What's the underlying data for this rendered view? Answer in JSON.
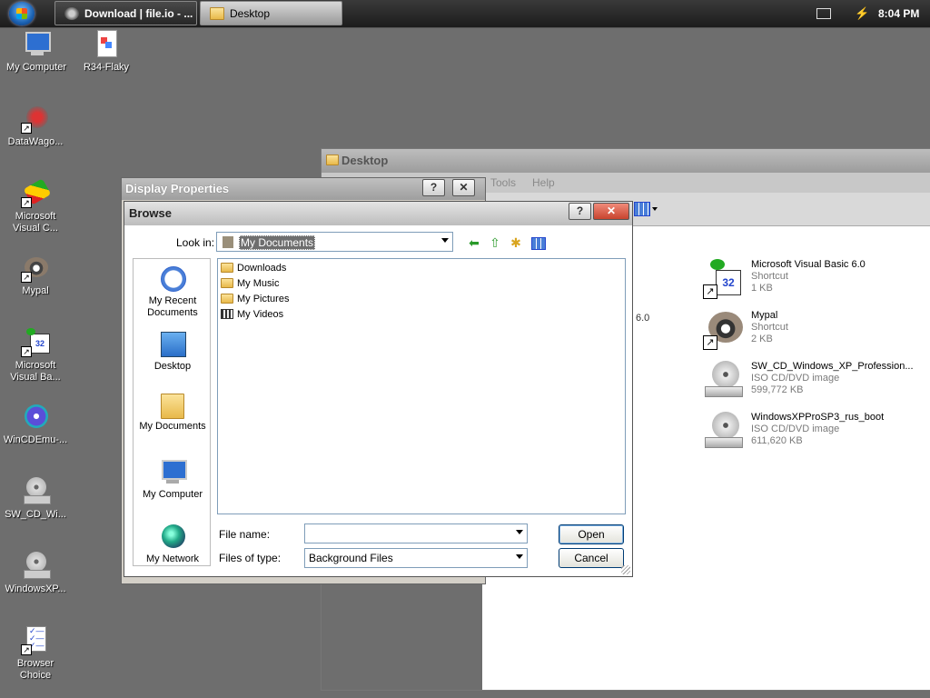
{
  "taskbar": {
    "tasks": [
      {
        "label": "Download | file.io - ..."
      },
      {
        "label": "Desktop"
      }
    ],
    "clock": "8:04 PM"
  },
  "desktop": {
    "icons": [
      {
        "label": "My Computer"
      },
      {
        "label": "R34-Flaky"
      },
      {
        "label": "DataWago..."
      },
      {
        "label": "Microsoft Visual C..."
      },
      {
        "label": "Mypal"
      },
      {
        "label": "Microsoft Visual Ba..."
      },
      {
        "label": "WinCDEmu-..."
      },
      {
        "label": "SW_CD_Wi..."
      },
      {
        "label": "WindowsXP..."
      },
      {
        "label": "Browser Choice"
      }
    ]
  },
  "explorer": {
    "title": "Desktop",
    "menu": [
      "Tools",
      "Help"
    ],
    "stray_text": "6.0",
    "files": [
      {
        "name": "Microsoft Visual Basic 6.0",
        "type": "Shortcut",
        "size": "1 KB"
      },
      {
        "name": "Mypal",
        "type": "Shortcut",
        "size": "2 KB"
      },
      {
        "name": "SW_CD_Windows_XP_Profession...",
        "type": "ISO CD/DVD image",
        "size": "599,772 KB"
      },
      {
        "name": "WindowsXPProSP3_rus_boot",
        "type": "ISO CD/DVD image",
        "size": "611,620 KB"
      }
    ]
  },
  "display_properties": {
    "title": "Display Properties",
    "help": "?",
    "close": "✕"
  },
  "browse": {
    "title": "Browse",
    "help": "?",
    "close": "✕",
    "look_in_label": "Look in:",
    "look_in_value": "My Documents",
    "places": [
      {
        "label": "My Recent Documents"
      },
      {
        "label": "Desktop"
      },
      {
        "label": "My Documents"
      },
      {
        "label": "My Computer"
      },
      {
        "label": "My Network"
      }
    ],
    "items": [
      {
        "label": "Downloads"
      },
      {
        "label": "My Music"
      },
      {
        "label": "My Pictures"
      },
      {
        "label": "My Videos"
      }
    ],
    "file_name_label": "File name:",
    "file_name_value": "",
    "files_of_type_label": "Files of type:",
    "files_of_type_value": "Background Files",
    "open_label": "Open",
    "cancel_label": "Cancel"
  },
  "colors": {
    "desktop": "#6e6e6e",
    "dialog_face": "#ece9d8"
  }
}
